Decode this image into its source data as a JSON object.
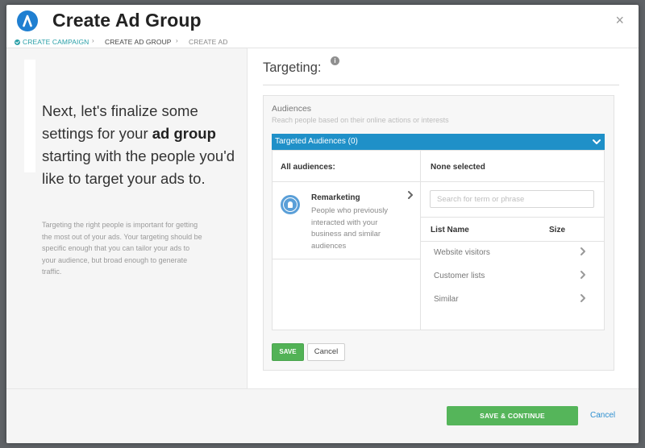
{
  "header": {
    "title": "Create Ad Group",
    "close_glyph": "×",
    "logo_icon": "brand-logo-icon",
    "accent_color": "#1f7fd1"
  },
  "breadcrumb": {
    "steps": [
      {
        "label": "CREATE CAMPAIGN",
        "state": "completed"
      },
      {
        "label": "CREATE AD GROUP",
        "state": "current"
      },
      {
        "label": "CREATE AD",
        "state": "upcoming"
      }
    ],
    "separator": "›"
  },
  "left_panel": {
    "headline_part1": "Next, let's finalize some settings for your ",
    "headline_bold": "ad group",
    "headline_part2": " starting with the people you'd like to target your ads to.",
    "subtext": "Targeting the right people is important for getting the most out of your ads. Your targeting should be specific enough that you can tailor your ads to your audience, but broad enough to generate traffic."
  },
  "targeting": {
    "title": "Targeting:",
    "info_glyph": "i"
  },
  "audiences": {
    "title": "Audiences",
    "subtitle": "Reach people based on their online actions or interests",
    "bar_label": "Targeted Audiences (0)",
    "bar_color": "#1f90c8",
    "all_audiences_header": "All audiences:",
    "selected_header": "None selected",
    "remarketing": {
      "title": "Remarketing",
      "description": "People who previously interacted with your business and similar audiences",
      "icon": "user-circle-icon"
    },
    "search_placeholder": "Search for term or phrase",
    "list_columns": {
      "name": "List Name",
      "size": "Size"
    },
    "lists": [
      {
        "name": "Website visitors"
      },
      {
        "name": "Customer lists"
      },
      {
        "name": "Similar"
      }
    ],
    "save_label": "SAVE",
    "cancel_label": "Cancel"
  },
  "footer": {
    "save_continue_label": "SAVE & CONTINUE",
    "cancel_label": "Cancel",
    "save_color": "#55b55a",
    "link_color": "#2d8fd0"
  }
}
